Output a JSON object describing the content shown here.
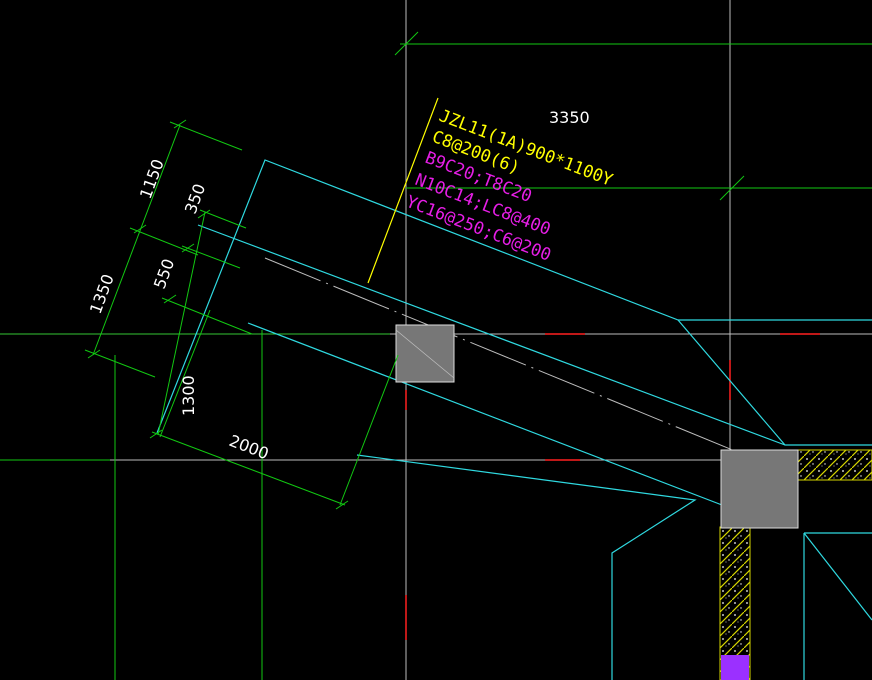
{
  "colors": {
    "background": "#000000",
    "grid": "#bdbdbd",
    "dimension": "#12c812",
    "outline": "#2fd9e0",
    "leader": "#ffff00",
    "annotation_yellow": "#ffff00",
    "annotation_magenta": "#e61ee6",
    "column": "#777777",
    "hatch": "#d6d600",
    "purple_fill": "#9b30ff",
    "red_mark": "#ff2020",
    "dim_text": "#ffffff"
  },
  "dimensions": {
    "top_span": "3350",
    "d1150": "1150",
    "d350": "350",
    "d1350": "1350",
    "d550": "550",
    "d1300": "1300",
    "d2000": "2000"
  },
  "annotation": {
    "line1": "JZL11(1A)900*1100Y",
    "line2": "C8@200(6)",
    "line3": "B9C20;T8C20",
    "line4": "N10C14;LC8@400",
    "line5": "YC16@250;C6@200"
  }
}
